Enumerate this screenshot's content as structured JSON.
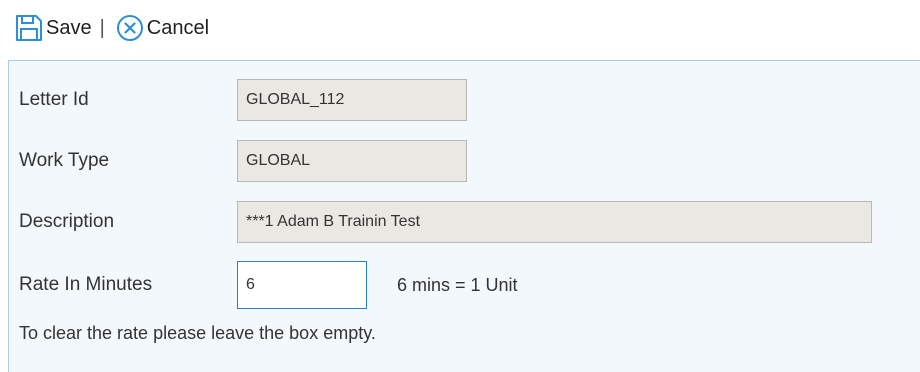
{
  "toolbar": {
    "save_label": "Save",
    "separator": "|",
    "cancel_label": "Cancel"
  },
  "form": {
    "letter_id": {
      "label": "Letter Id",
      "value": "GLOBAL_112"
    },
    "work_type": {
      "label": "Work Type",
      "value": "GLOBAL"
    },
    "description": {
      "label": "Description",
      "value": "***1 Adam B Trainin Test"
    },
    "rate": {
      "label": "Rate In Minutes",
      "value": "6",
      "unit_text": "6 mins = 1 Unit"
    },
    "note": "To clear the rate please leave the box empty."
  },
  "colors": {
    "accent": "#2f7fc4",
    "panel_bg": "#f3f8fc",
    "panel_border": "#a9cce8",
    "readonly_bg": "#ebe8e3"
  },
  "icons": {
    "save": "save-floppy-icon",
    "cancel": "cancel-circle-x-icon"
  }
}
